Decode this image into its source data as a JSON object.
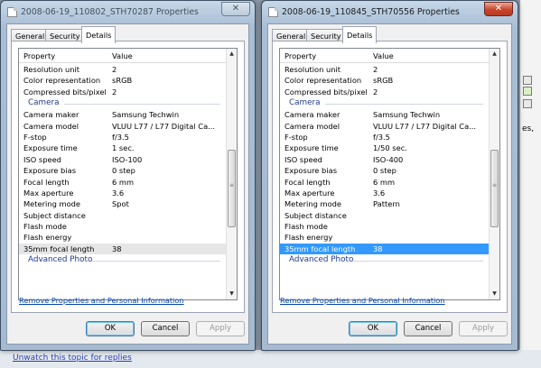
{
  "background": {
    "side_text": "es,",
    "bottom_link": "Unwatch this topic for replies"
  },
  "windows": [
    {
      "title": "2008-06-19_110802_STH70287 Properties",
      "close_glyph": "✕",
      "tabs": [
        "General",
        "Security",
        "Details"
      ],
      "active_tab": "Details",
      "columns": [
        "Property",
        "Value"
      ],
      "rows": [
        {
          "k": "Resolution unit",
          "v": "2"
        },
        {
          "k": "Color representation",
          "v": "sRGB"
        },
        {
          "k": "Compressed bits/pixel",
          "v": "2"
        },
        {
          "k": "Camera",
          "v": "",
          "group": true
        },
        {
          "k": "Camera maker",
          "v": "Samsung Techwin"
        },
        {
          "k": "Camera model",
          "v": "VLUU L77 / L77 Digital Ca..."
        },
        {
          "k": "F-stop",
          "v": "f/3.5"
        },
        {
          "k": "Exposure time",
          "v": "1 sec."
        },
        {
          "k": "ISO speed",
          "v": "ISO-100"
        },
        {
          "k": "Exposure bias",
          "v": "0 step"
        },
        {
          "k": "Focal length",
          "v": "6 mm"
        },
        {
          "k": "Max aperture",
          "v": "3.6"
        },
        {
          "k": "Metering mode",
          "v": "Spot"
        },
        {
          "k": "Subject distance",
          "v": ""
        },
        {
          "k": "Flash mode",
          "v": ""
        },
        {
          "k": "Flash energy",
          "v": ""
        },
        {
          "k": "35mm focal length",
          "v": "38",
          "selected": "gray"
        },
        {
          "k": "Advanced Photo",
          "v": "",
          "group": true
        }
      ],
      "remove_link": "Remove Properties and Personal Information",
      "buttons": {
        "ok": "OK",
        "cancel": "Cancel",
        "apply": "Apply"
      }
    },
    {
      "title": "2008-06-19_110845_STH70556 Properties",
      "close_glyph": "✕",
      "tabs": [
        "General",
        "Security",
        "Details"
      ],
      "active_tab": "Details",
      "columns": [
        "Property",
        "Value"
      ],
      "rows": [
        {
          "k": "Resolution unit",
          "v": "2"
        },
        {
          "k": "Color representation",
          "v": "sRGB"
        },
        {
          "k": "Compressed bits/pixel",
          "v": "2"
        },
        {
          "k": "Camera",
          "v": "",
          "group": true
        },
        {
          "k": "Camera maker",
          "v": "Samsung Techwin"
        },
        {
          "k": "Camera model",
          "v": "VLUU L77 / L77 Digital Ca..."
        },
        {
          "k": "F-stop",
          "v": "f/3.5"
        },
        {
          "k": "Exposure time",
          "v": "1/50 sec."
        },
        {
          "k": "ISO speed",
          "v": "ISO-400"
        },
        {
          "k": "Exposure bias",
          "v": "0 step"
        },
        {
          "k": "Focal length",
          "v": "6 mm"
        },
        {
          "k": "Max aperture",
          "v": "3.6"
        },
        {
          "k": "Metering mode",
          "v": "Pattern"
        },
        {
          "k": "Subject distance",
          "v": ""
        },
        {
          "k": "Flash mode",
          "v": ""
        },
        {
          "k": "Flash energy",
          "v": ""
        },
        {
          "k": "35mm focal length",
          "v": "38",
          "selected": "blue"
        },
        {
          "k": "Advanced Photo",
          "v": "",
          "group": true
        }
      ],
      "remove_link": "Remove Properties and Personal Information",
      "buttons": {
        "ok": "OK",
        "cancel": "Cancel",
        "apply": "Apply"
      }
    }
  ]
}
